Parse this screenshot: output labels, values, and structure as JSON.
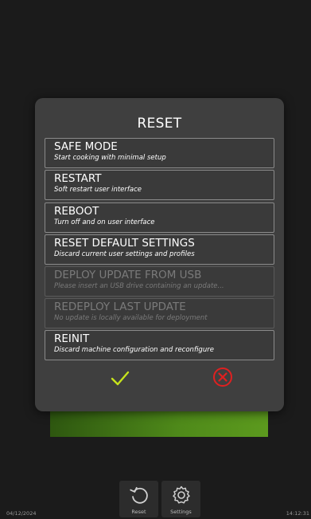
{
  "dialog": {
    "title": "RESET",
    "options": [
      {
        "title": "SAFE MODE",
        "subtitle": "Start cooking with minimal setup",
        "enabled": true
      },
      {
        "title": "RESTART",
        "subtitle": "Soft restart user interface",
        "enabled": true
      },
      {
        "title": "REBOOT",
        "subtitle": "Turn off and on user interface",
        "enabled": true
      },
      {
        "title": "RESET DEFAULT SETTINGS",
        "subtitle": "Discard current user settings and profiles",
        "enabled": true
      },
      {
        "title": "DEPLOY UPDATE FROM USB",
        "subtitle": "Please insert an USB drive containing an update...",
        "enabled": false
      },
      {
        "title": "REDEPLOY LAST UPDATE",
        "subtitle": "No update is locally available for deployment",
        "enabled": false
      },
      {
        "title": "REINIT",
        "subtitle": "Discard machine configuration and reconfigure",
        "enabled": true
      }
    ],
    "confirm_icon": "checkmark-icon",
    "cancel_icon": "close-circle-icon",
    "confirm_color": "#c6e31c",
    "cancel_color": "#e02020"
  },
  "footer": {
    "date": "04/12/2024",
    "time": "14:12:31",
    "buttons": [
      {
        "label": "Reset",
        "icon": "reset-icon"
      },
      {
        "label": "Settings",
        "icon": "gear-icon"
      }
    ]
  },
  "colors": {
    "background": "#1b1b1b",
    "dialog": "#3f3f3f",
    "progress_green": "#4f8a1a"
  }
}
